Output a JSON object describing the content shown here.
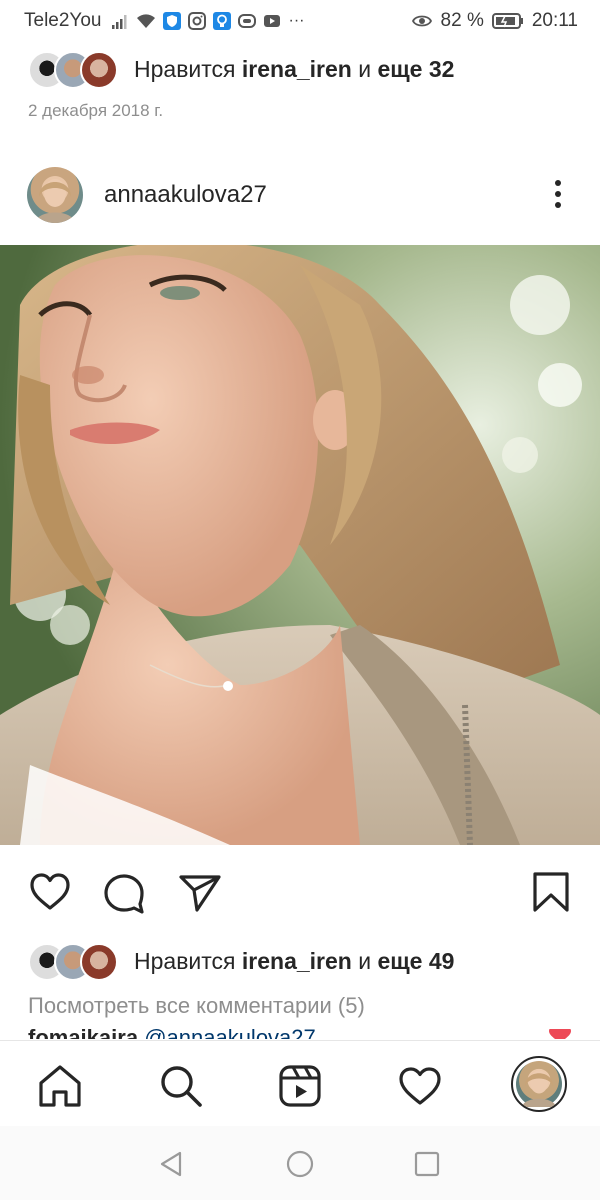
{
  "status_bar": {
    "carrier": "Tele2You",
    "battery": "82 %",
    "time": "20:11",
    "more": "···"
  },
  "top_likes": {
    "prefix": "Нравится ",
    "user": "irena_iren",
    "middle": " и ",
    "rest": "еще 32"
  },
  "date": "2 декабря 2018 г.",
  "post": {
    "username": "annaakulova27"
  },
  "bottom_likes": {
    "prefix": "Нравится ",
    "user": "irena_iren",
    "middle": " и ",
    "rest": "еще 49"
  },
  "comments": {
    "view_all": "Посмотреть все комментарии (5)",
    "peek_user": "fomaikaira",
    "peek_mention": "@annaakulova27"
  },
  "colors": {
    "text": "#262626",
    "secondary": "#8e8e8e",
    "mention": "#00376b",
    "heart": "#ed4956"
  },
  "icons": {
    "like": "heart-icon",
    "comment": "comment-icon",
    "share": "send-icon",
    "save": "bookmark-icon",
    "home": "home-icon",
    "search": "search-icon",
    "reels": "reels-icon",
    "activity": "heart-icon"
  }
}
